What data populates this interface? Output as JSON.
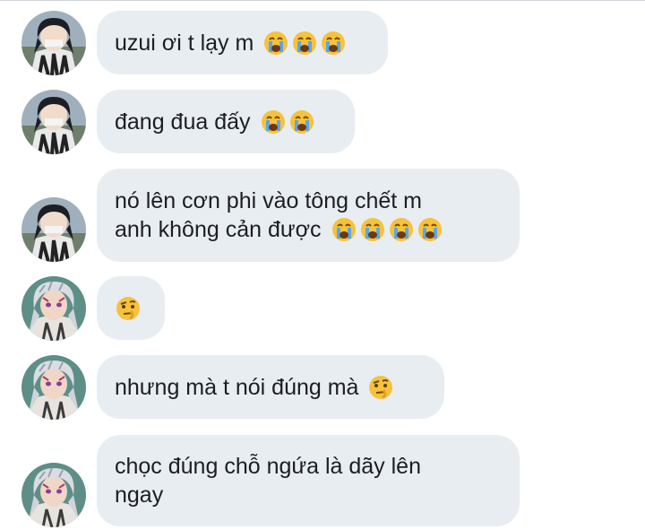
{
  "messages": [
    {
      "sender": "obanai",
      "lines": [
        {
          "text": "uzui ơi t lạy m",
          "emojis": [
            "crying-emoji",
            "crying-emoji",
            "crying-emoji"
          ]
        }
      ]
    },
    {
      "sender": "obanai",
      "lines": [
        {
          "text": "đang đua đấy",
          "emojis": [
            "crying-emoji",
            "crying-emoji"
          ]
        }
      ]
    },
    {
      "sender": "obanai",
      "lines": [
        {
          "text": "nó lên cơn phi vào tông chết m",
          "emojis": []
        },
        {
          "text": "anh không cản được",
          "emojis": [
            "crying-emoji",
            "crying-emoji",
            "crying-emoji",
            "crying-emoji"
          ]
        }
      ]
    },
    {
      "sender": "uzui",
      "lines": [
        {
          "text": "",
          "emojis": [
            "raised-eyebrow-emoji"
          ]
        }
      ]
    },
    {
      "sender": "uzui",
      "lines": [
        {
          "text": "nhưng mà t nói đúng mà",
          "emojis": [
            "raised-eyebrow-emoji"
          ]
        }
      ]
    },
    {
      "sender": "uzui",
      "lines": [
        {
          "text": "chọc đúng chỗ ngứa là dãy lên",
          "emojis": []
        },
        {
          "text": "ngay",
          "emojis": []
        }
      ]
    }
  ],
  "colors": {
    "bubble_bg": "#e8edf2",
    "text": "#1c1e21",
    "page_bg": "#ffffff"
  }
}
